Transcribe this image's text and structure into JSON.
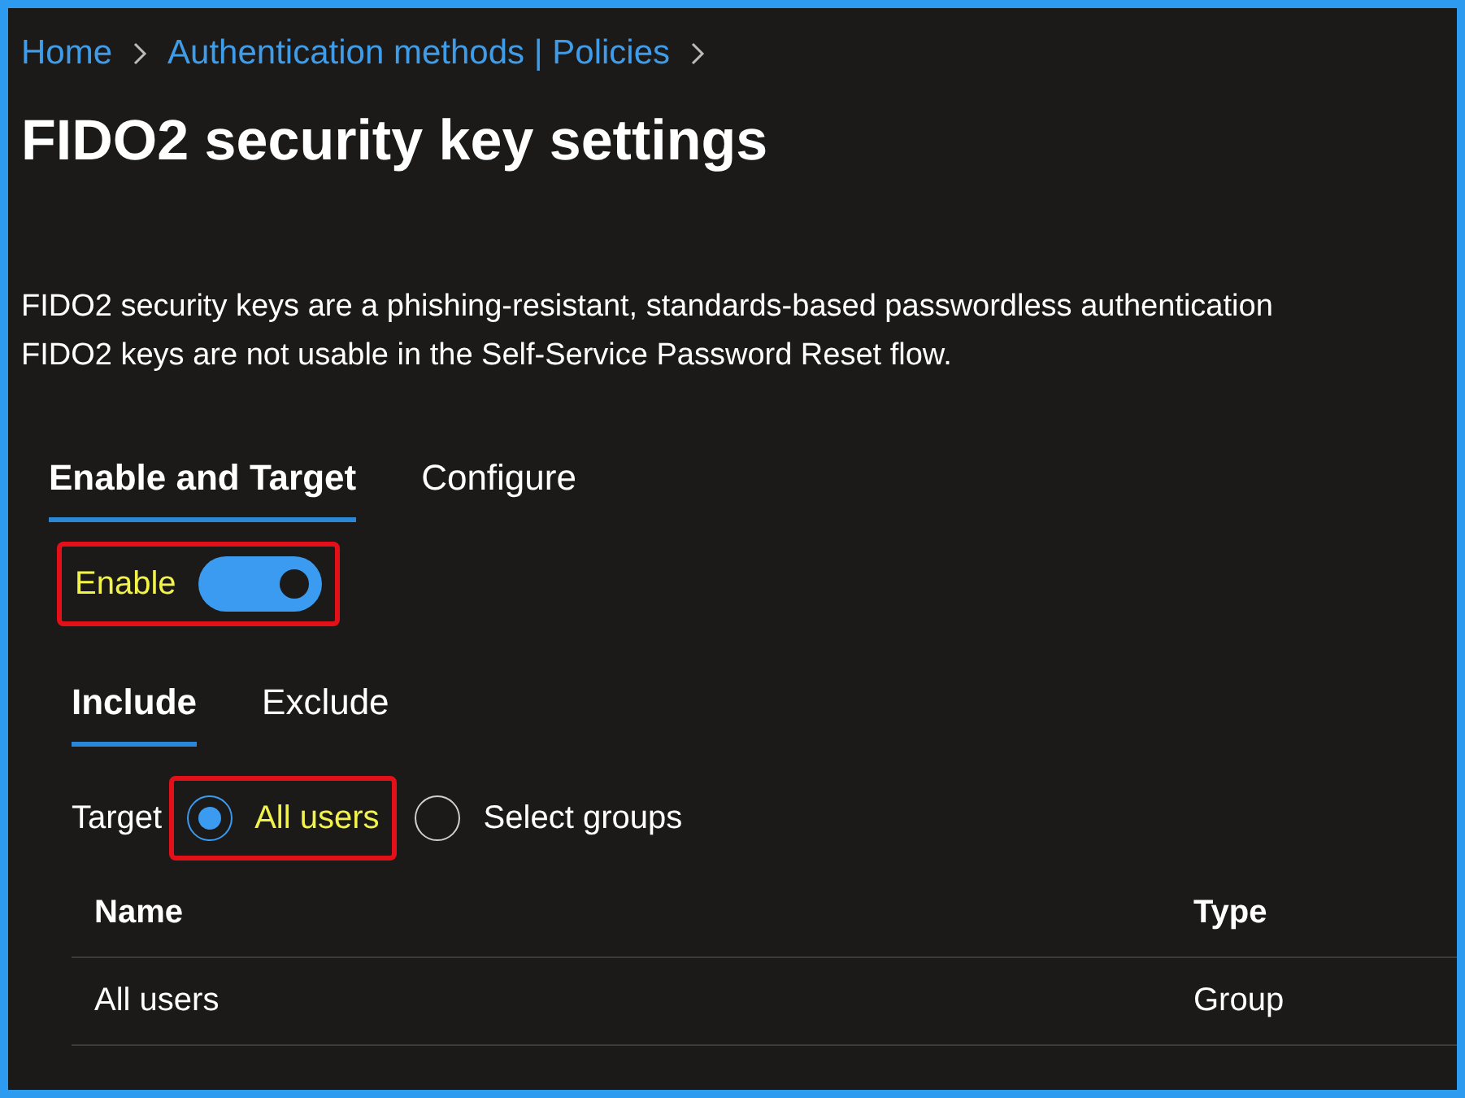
{
  "breadcrumb": [
    "Home",
    "Authentication methods | Policies"
  ],
  "title": "FIDO2 security key settings",
  "description": [
    "FIDO2 security keys are a phishing-resistant, standards-based passwordless authentication",
    "FIDO2 keys are not usable in the Self-Service Password Reset flow."
  ],
  "tabs": [
    {
      "label": "Enable and Target",
      "selected": true
    },
    {
      "label": "Configure",
      "selected": false
    }
  ],
  "enable": {
    "label": "Enable",
    "on": true,
    "highlighted": true
  },
  "sub_tabs": [
    {
      "label": "Include",
      "selected": true
    },
    {
      "label": "Exclude",
      "selected": false
    }
  ],
  "target": {
    "label": "Target",
    "options": [
      {
        "label": "All users",
        "selected": true,
        "highlighted": true
      },
      {
        "label": "Select groups",
        "selected": false,
        "highlighted": false
      }
    ]
  },
  "table": {
    "columns": [
      "Name",
      "Type"
    ],
    "rows": [
      [
        "All users",
        "Group"
      ]
    ]
  }
}
